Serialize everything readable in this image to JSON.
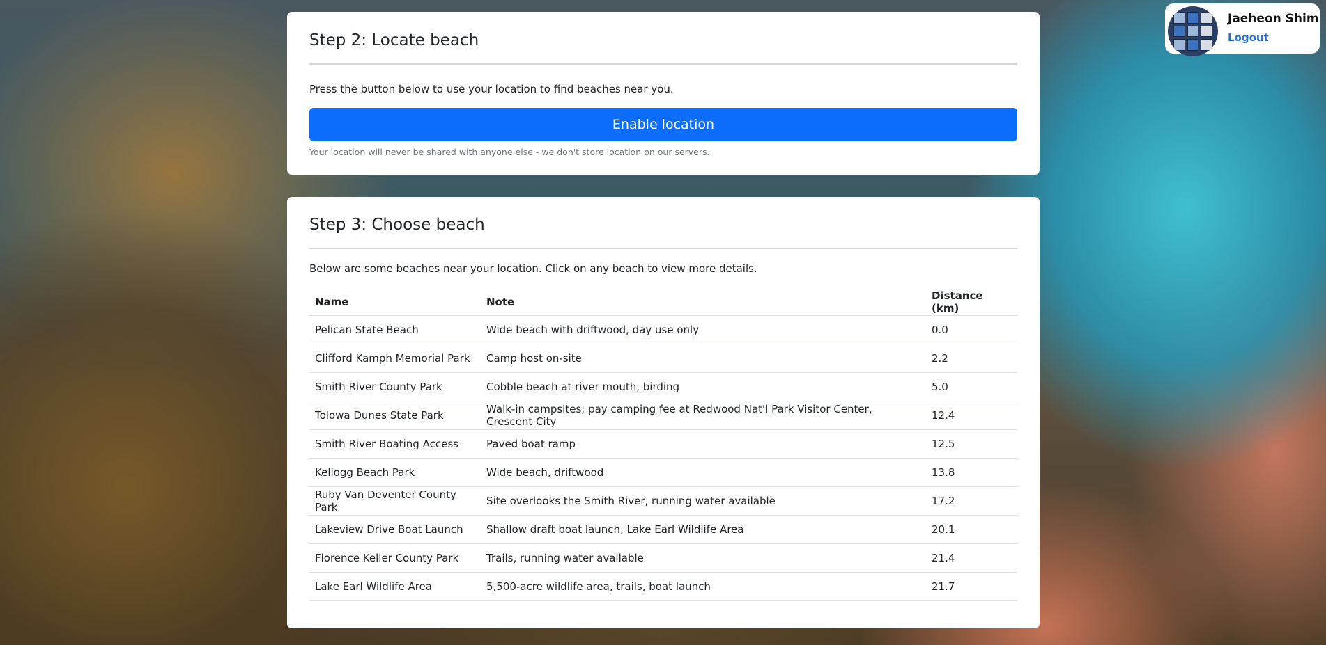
{
  "user": {
    "name": "Jaeheon Shim",
    "logout_label": "Logout"
  },
  "step2": {
    "title": "Step 2: Locate beach",
    "instruction": "Press the button below to use your location to find beaches near you.",
    "button_label": "Enable location",
    "privacy_note": "Your location will never be shared with anyone else - we don't store location on our servers."
  },
  "step3": {
    "title": "Step 3: Choose beach",
    "instruction": "Below are some beaches near your location. Click on any beach to view more details.",
    "columns": [
      "Name",
      "Note",
      "Distance (km)"
    ],
    "rows": [
      {
        "name": "Pelican State Beach",
        "note": "Wide beach with driftwood, day use only",
        "distance": "0.0"
      },
      {
        "name": "Clifford Kamph Memorial Park",
        "note": "Camp host on-site",
        "distance": "2.2"
      },
      {
        "name": "Smith River County Park",
        "note": "Cobble beach at river mouth, birding",
        "distance": "5.0"
      },
      {
        "name": "Tolowa Dunes State Park",
        "note": "Walk-in campsites; pay camping fee at Redwood Nat'l Park Visitor Center, Crescent City",
        "distance": "12.4"
      },
      {
        "name": "Smith River Boating Access",
        "note": "Paved boat ramp",
        "distance": "12.5"
      },
      {
        "name": "Kellogg Beach Park",
        "note": "Wide beach, driftwood",
        "distance": "13.8"
      },
      {
        "name": "Ruby Van Deventer County Park",
        "note": "Site overlooks the Smith River, running water available",
        "distance": "17.2"
      },
      {
        "name": "Lakeview Drive Boat Launch",
        "note": "Shallow draft boat launch, Lake Earl Wildlife Area",
        "distance": "20.1"
      },
      {
        "name": "Florence Keller County Park",
        "note": "Trails, running water available",
        "distance": "21.4"
      },
      {
        "name": "Lake Earl Wildlife Area",
        "note": "5,500-acre wildlife area, trails, boat launch",
        "distance": "21.7"
      }
    ]
  }
}
